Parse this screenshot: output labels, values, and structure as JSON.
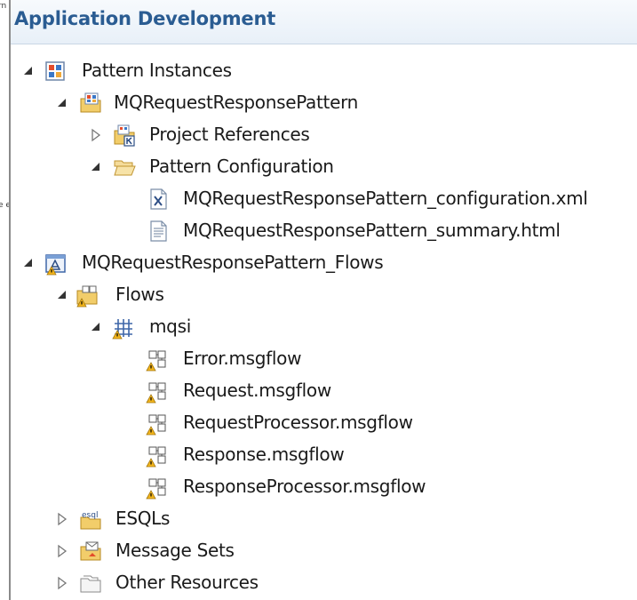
{
  "panel": {
    "title": "Application Development"
  },
  "left_strip": {
    "fragment_top": "rn",
    "fragment_mid": "e e"
  },
  "tree": [
    {
      "label": "Pattern Instances",
      "expanded": true,
      "icon": "pattern-instances-icon"
    },
    {
      "label": "MQRequestResponsePattern",
      "expanded": true,
      "icon": "pattern-project-icon"
    },
    {
      "label": "Project References",
      "expanded": false,
      "icon": "project-references-icon"
    },
    {
      "label": "Pattern Configuration",
      "expanded": true,
      "icon": "folder-open-icon"
    },
    {
      "label": "MQRequestResponsePattern_configuration.xml",
      "icon": "xml-file-icon"
    },
    {
      "label": "MQRequestResponsePattern_summary.html",
      "icon": "html-file-icon"
    },
    {
      "label": "MQRequestResponsePattern_Flows",
      "expanded": true,
      "icon": "application-project-icon"
    },
    {
      "label": "Flows",
      "expanded": true,
      "icon": "flows-warning-icon"
    },
    {
      "label": "mqsi",
      "expanded": true,
      "icon": "broker-schema-warning-icon"
    },
    {
      "label": "Error.msgflow",
      "icon": "msgflow-warning-icon"
    },
    {
      "label": "Request.msgflow",
      "icon": "msgflow-warning-icon"
    },
    {
      "label": "RequestProcessor.msgflow",
      "icon": "msgflow-warning-icon"
    },
    {
      "label": "Response.msgflow",
      "icon": "msgflow-warning-icon"
    },
    {
      "label": "ResponseProcessor.msgflow",
      "icon": "msgflow-warning-icon"
    },
    {
      "label": "ESQLs",
      "expanded": false,
      "icon": "esql-icon",
      "icon_text": "esql"
    },
    {
      "label": "Message Sets",
      "expanded": false,
      "icon": "message-sets-icon"
    },
    {
      "label": "Other Resources",
      "expanded": false,
      "icon": "other-resources-icon"
    }
  ],
  "colors": {
    "title": "#2a5c92",
    "header_bg": "#e8f0f8",
    "warning": "#f2b41c"
  }
}
